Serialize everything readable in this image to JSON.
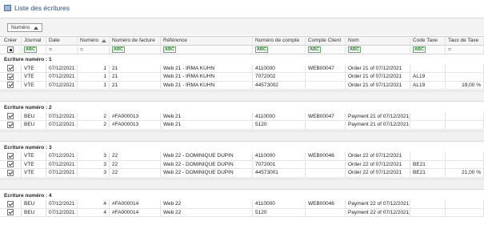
{
  "window": {
    "title": "Liste des écritures"
  },
  "group_by": {
    "label": "Numéro"
  },
  "columns": [
    "Créer",
    "Journal",
    "Date",
    "Numéro",
    "Numéro de facture",
    "Référence",
    "Numéro de compte",
    "Compte Client",
    "Nom",
    "Code Taxe",
    "Taux de Taxe"
  ],
  "filter_symbols": {
    "eq": "=",
    "abc": "ABC"
  },
  "groups": [
    {
      "label": "Ecriture numéro : 1",
      "rows": [
        {
          "journal": "VTE",
          "date": "07/12/2021",
          "numero": "1",
          "facture": "21",
          "reference": "Web 21 - IRMA KUHN",
          "compte": "4110000",
          "client": "WEB00047",
          "nom": "Order 21 of 07/12/2021",
          "code_taxe": "",
          "taux": ""
        },
        {
          "journal": "VTE",
          "date": "07/12/2021",
          "numero": "1",
          "facture": "21",
          "reference": "Web 21 - IRMA KUHN",
          "compte": "7072002",
          "client": "",
          "nom": "Order 21 of 07/12/2021",
          "code_taxe": "AL19",
          "taux": ""
        },
        {
          "journal": "VTE",
          "date": "07/12/2021",
          "numero": "1",
          "facture": "21",
          "reference": "Web 21 - IRMA KUHN",
          "compte": "44573002",
          "client": "",
          "nom": "Order 21 of 07/12/2021",
          "code_taxe": "AL19",
          "taux": "19,00 %"
        }
      ]
    },
    {
      "label": "Ecriture numéro : 2",
      "rows": [
        {
          "journal": "BEU",
          "date": "07/12/2021",
          "numero": "2",
          "facture": "#FA000013",
          "reference": "Web 21",
          "compte": "4110000",
          "client": "WEB00047",
          "nom": "Payment 21 of 07/12/2021",
          "code_taxe": "",
          "taux": ""
        },
        {
          "journal": "BEU",
          "date": "07/12/2021",
          "numero": "2",
          "facture": "#FA000013",
          "reference": "Web 21",
          "compte": "5120",
          "client": "",
          "nom": "Payment 21 of 07/12/2021",
          "code_taxe": "",
          "taux": ""
        }
      ]
    },
    {
      "label": "Ecriture numéro : 3",
      "rows": [
        {
          "journal": "VTE",
          "date": "07/12/2021",
          "numero": "3",
          "facture": "22",
          "reference": "Web 22 - DOMINIQUE DUPIN",
          "compte": "4110000",
          "client": "WEB00046",
          "nom": "Order 22 of 07/12/2021",
          "code_taxe": "",
          "taux": ""
        },
        {
          "journal": "VTE",
          "date": "07/12/2021",
          "numero": "3",
          "facture": "22",
          "reference": "Web 22 - DOMINIQUE DUPIN",
          "compte": "7072001",
          "client": "",
          "nom": "Order 22 of 07/12/2021",
          "code_taxe": "BE21",
          "taux": ""
        },
        {
          "journal": "VTE",
          "date": "07/12/2021",
          "numero": "3",
          "facture": "22",
          "reference": "Web 22 - DOMINIQUE DUPIN",
          "compte": "44573001",
          "client": "",
          "nom": "Order 22 of 07/12/2021",
          "code_taxe": "BE21",
          "taux": "21,00 %"
        }
      ]
    },
    {
      "label": "Ecriture numéro : 4",
      "rows": [
        {
          "journal": "BEU",
          "date": "07/12/2021",
          "numero": "4",
          "facture": "#FA000014",
          "reference": "Web 22",
          "compte": "4110000",
          "client": "WEB00046",
          "nom": "Payment 22 of 07/12/2021",
          "code_taxe": "",
          "taux": ""
        },
        {
          "journal": "BEU",
          "date": "07/12/2021",
          "numero": "4",
          "facture": "#FA000014",
          "reference": "Web 22",
          "compte": "5120",
          "client": "",
          "nom": "Payment 22 of 07/12/2021",
          "code_taxe": "",
          "taux": ""
        }
      ]
    }
  ]
}
